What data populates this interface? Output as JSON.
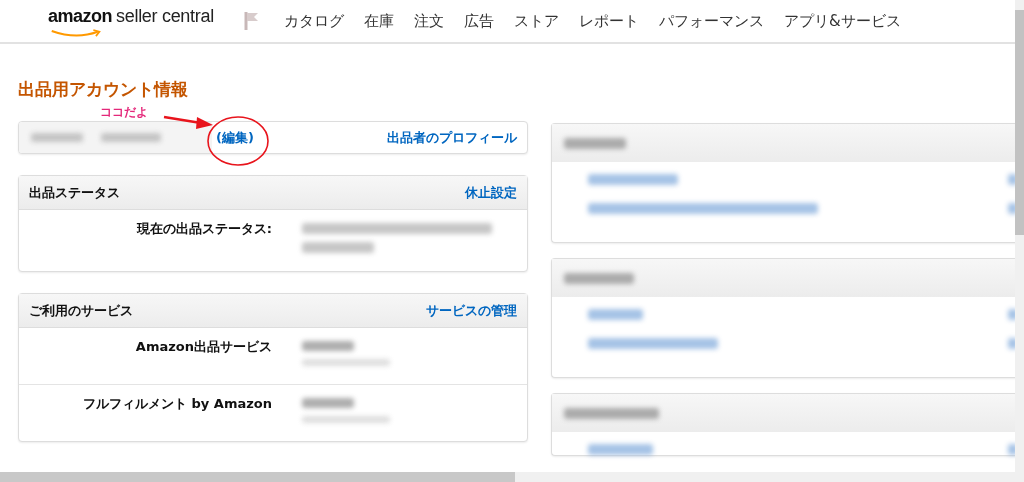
{
  "header": {
    "logo": {
      "brand": "amazon",
      "product": "seller central"
    },
    "nav": [
      {
        "label": "カタログ"
      },
      {
        "label": "在庫"
      },
      {
        "label": "注文"
      },
      {
        "label": "広告"
      },
      {
        "label": "ストア"
      },
      {
        "label": "レポート"
      },
      {
        "label": "パフォーマンス"
      },
      {
        "label": "アプリ&サービス"
      }
    ]
  },
  "page_title": "出品用アカウント情報",
  "annotation": {
    "text": "ココだよ"
  },
  "profile_card": {
    "edit_link": "(編集)",
    "profile_link": "出品者のプロフィール"
  },
  "sections": [
    {
      "title": "出品ステータス",
      "action": "休止設定",
      "rows": [
        {
          "label": "現在の出品ステータス:",
          "kind": "long"
        }
      ]
    },
    {
      "title": "ご利用のサービス",
      "action": "サービスの管理",
      "rows": [
        {
          "label": "Amazon出品サービス",
          "kind": "short"
        },
        {
          "label": "フルフィルメント by Amazon",
          "kind": "short"
        }
      ]
    }
  ]
}
